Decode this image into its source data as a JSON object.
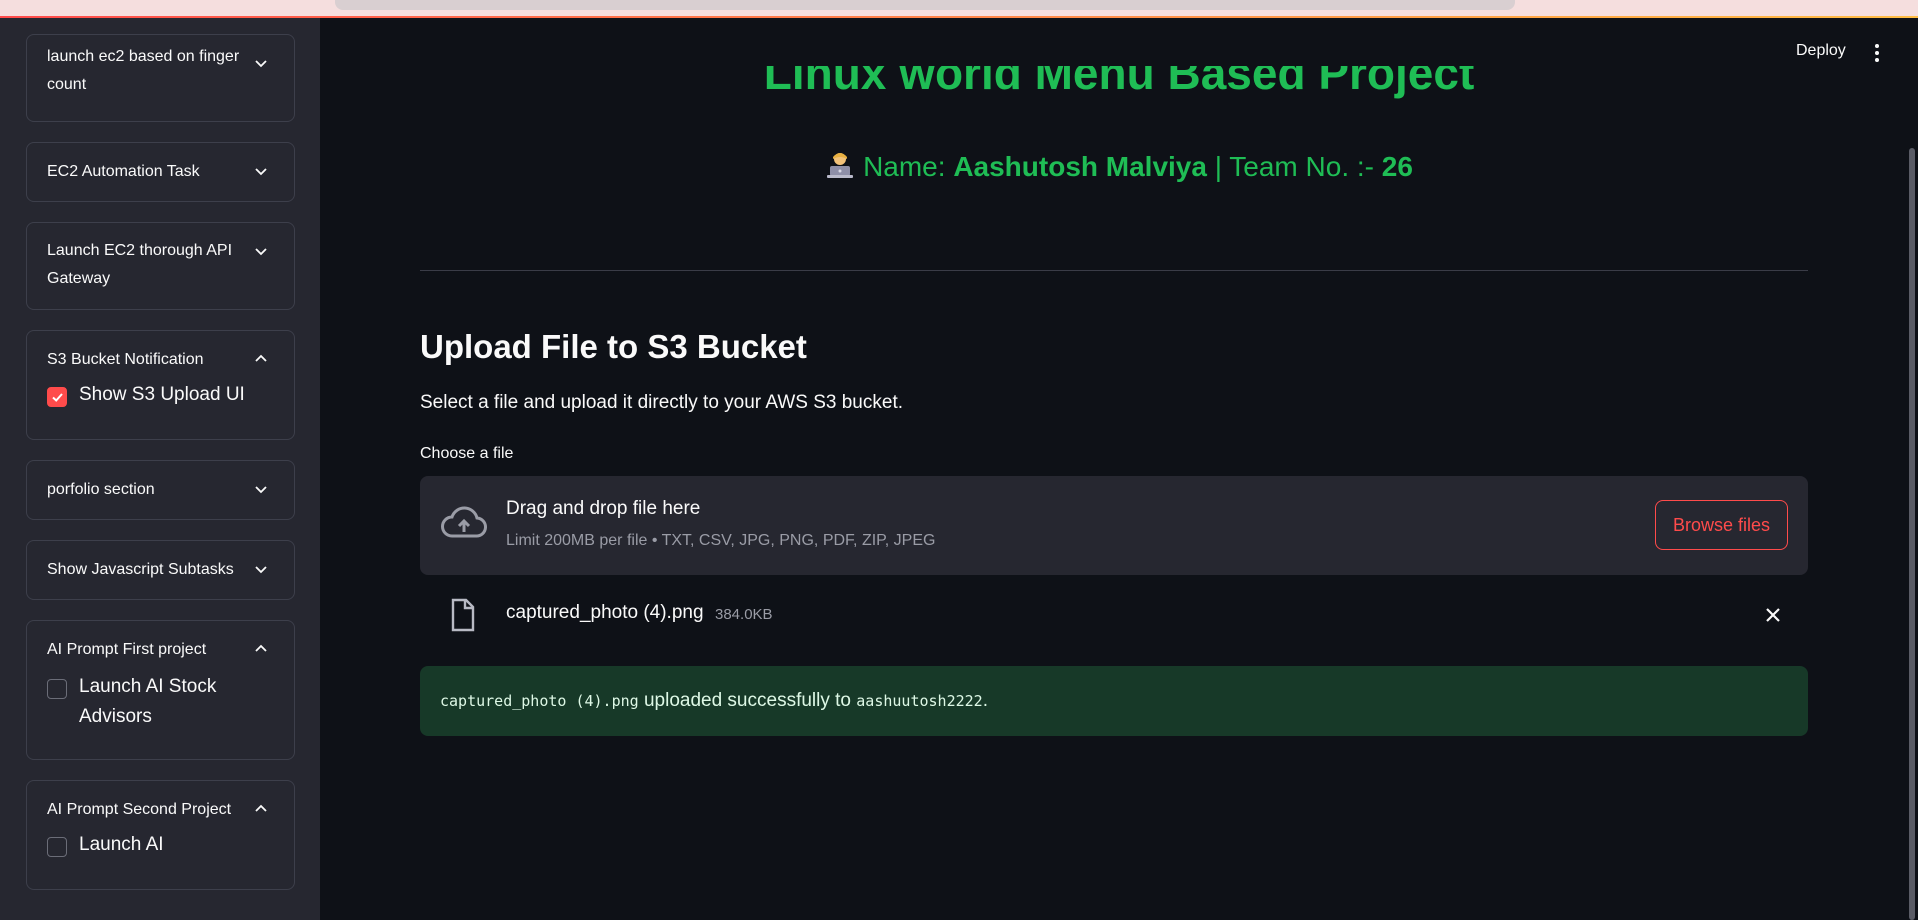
{
  "header": {
    "deploy_label": "Deploy"
  },
  "sidebar": {
    "expanders": [
      {
        "label": "launch ec2 based on finger count",
        "expanded": false
      },
      {
        "label": "EC2 Automation Task",
        "expanded": false
      },
      {
        "label": "Launch EC2 thorough API Gateway",
        "expanded": false
      },
      {
        "label": "S3 Bucket Notification",
        "expanded": true,
        "checkbox": {
          "label": "Show S3 Upload UI",
          "checked": true
        }
      },
      {
        "label": "porfolio section",
        "expanded": false
      },
      {
        "label": "Show Javascript Subtasks",
        "expanded": false
      },
      {
        "label": "AI Prompt First project",
        "expanded": true,
        "checkbox": {
          "label": "Launch AI Stock Advisors",
          "checked": false
        }
      },
      {
        "label": "AI Prompt Second Project",
        "expanded": true,
        "checkbox": {
          "label": "Launch AI",
          "checked": false
        }
      }
    ]
  },
  "main": {
    "title": "Linux world Menu Based Project",
    "subtitle": {
      "prefix": "Name: ",
      "name": "Aashutosh Malviya",
      "middle": " | Team No. :- ",
      "team": "26"
    },
    "section_title": "Upload File to S3 Bucket",
    "description": "Select a file and upload it directly to your AWS S3 bucket.",
    "uploader": {
      "label": "Choose a file",
      "drop_title": "Drag and drop file here",
      "drop_limit": "Limit 200MB per file • TXT, CSV, JPG, PNG, PDF, ZIP, JPEG",
      "browse_label": "Browse files"
    },
    "file": {
      "name": "captured_photo (4).png",
      "size": "384.0KB"
    },
    "success": {
      "file_code": "captured_photo (4).png",
      "message": " uploaded successfully to ",
      "bucket_code": "aashuutosh2222",
      "suffix": "."
    }
  },
  "colors": {
    "accent_green": "#1fbd55",
    "accent_red": "#ff4b4b",
    "success_bg": "#173928"
  }
}
